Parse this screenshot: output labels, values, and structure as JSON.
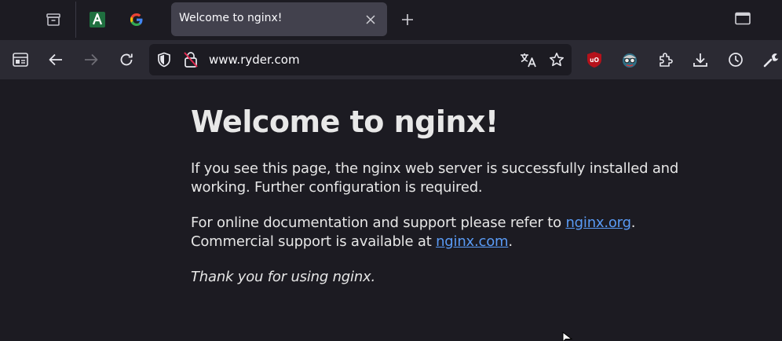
{
  "browser": {
    "tabs": [
      {
        "name": "tab-manager",
        "icon": "archive-icon"
      },
      {
        "name": "pinned-tab-a",
        "icon": "letter-a-icon",
        "color": "#2e8b57"
      },
      {
        "name": "pinned-tab-google",
        "icon": "google-icon"
      }
    ],
    "active_tab": {
      "title": "Welcome to nginx!"
    },
    "new_tab_icon": "plus-icon",
    "window_icon": "window-icon",
    "url": "www.ryder.com",
    "toolbar_icons": [
      "sidebar-icon",
      "back-icon",
      "forward-icon",
      "reload-icon",
      "shield-icon",
      "insecure-lock-icon",
      "translate-icon",
      "star-icon",
      "ublock-icon",
      "extension-avatar-icon",
      "puzzle-icon",
      "download-icon",
      "history-icon",
      "wrench-icon"
    ],
    "ublock_label": "uO"
  },
  "page": {
    "heading": "Welcome to nginx!",
    "para1": "If you see this page, the nginx web server is successfully installed and working. Further configuration is required.",
    "para2_prefix": "For online documentation and support please refer to ",
    "para2_link": "nginx.org",
    "para2_suffix": ".",
    "para3_prefix": "Commercial support is available at ",
    "para3_link": "nginx.com",
    "para3_suffix": ".",
    "thanks": "Thank you for using nginx."
  },
  "colors": {
    "link": "#5a9bf5",
    "ublock_red": "#c8102e",
    "accent_green": "#2e8b57"
  }
}
